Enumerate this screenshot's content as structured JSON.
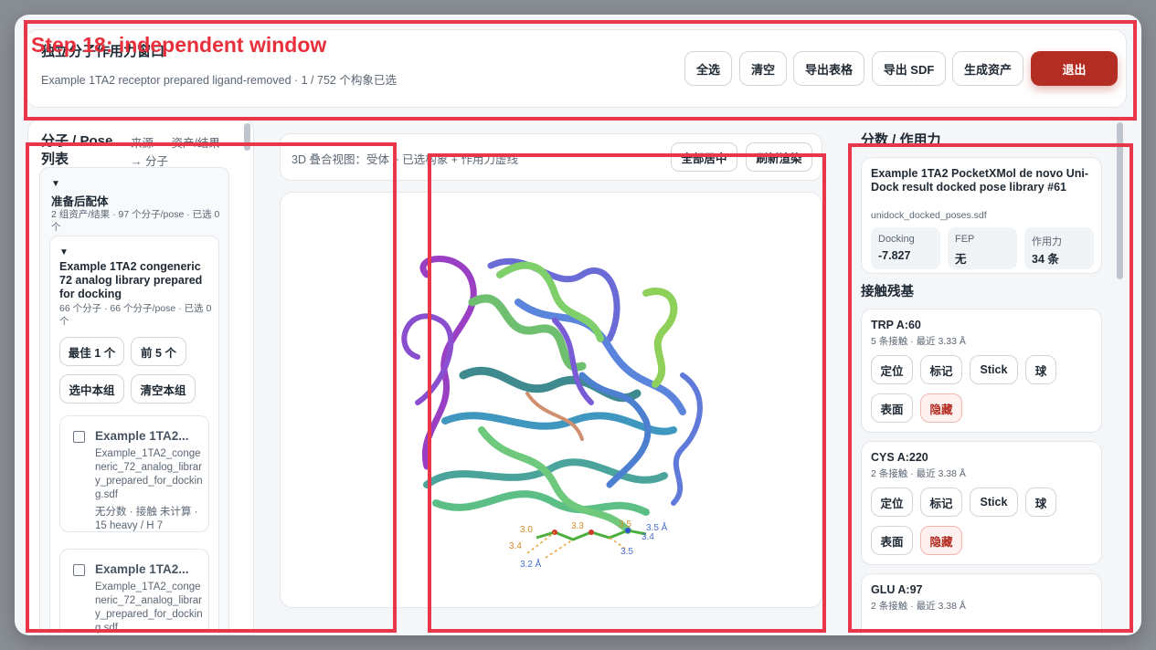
{
  "annotation": {
    "label": "Step 18: independent window"
  },
  "window": {
    "title": "独立分子作用力窗口",
    "subtitle": "Example 1TA2 receptor prepared ligand-removed · 1 / 752 个构象已选",
    "buttons": {
      "select_all": "全选",
      "clear": "清空",
      "export_table": "导出表格",
      "export_sdf": "导出 SDF",
      "generate_asset": "生成资产",
      "exit": "退出"
    }
  },
  "left_panel": {
    "title": "分子 / Pose 列表",
    "hint": "来源 → 资产/结果 → 分子",
    "group": {
      "title": "准备后配体",
      "meta": "2 组资产/结果 · 97 个分子/pose · 已选 0 个",
      "subgroup": {
        "title": "Example 1TA2 congeneric 72 analog library prepared for docking",
        "meta": "66 个分子 · 66 个分子/pose · 已选 0 个",
        "buttons": {
          "best1": "最佳 1 个",
          "top5": "前 5 个",
          "select_group": "选中本组",
          "clear_group": "清空本组"
        },
        "items": [
          {
            "name": "Example 1TA2...",
            "file": "Example_1TA2_congeneric_72_analog_library_prepared_for_docking.sdf",
            "meta": "无分数 · 接触 未计算 · 15 heavy / H 7"
          },
          {
            "name": "Example 1TA2...",
            "file": "Example_1TA2_congeneric_72_analog_library_prepared_for_docking.sdf",
            "meta": ""
          }
        ]
      }
    }
  },
  "viewer": {
    "title": "3D 叠合视图：受体 + 已选构象 + 作用力虚线",
    "center_all": "全部居中",
    "refresh": "刷新渲染",
    "distance_labels": [
      "3.0",
      "3.4",
      "3.3",
      "3.5",
      "3.5",
      "3.4",
      "3.2 Å",
      "3.5 Å"
    ]
  },
  "right_panel": {
    "title": "分数 / 作用力",
    "pose": {
      "title": "Example 1TA2 PocketXMol de novo Uni-Dock result docked pose library #61",
      "file": "unidock_docked_poses.sdf",
      "stats": [
        {
          "label": "Docking",
          "value": "-7.827"
        },
        {
          "label": "FEP",
          "value": "无"
        },
        {
          "label": "作用力",
          "value": "34 条"
        }
      ]
    },
    "contacts_title": "接触残基",
    "residues": [
      {
        "name": "TRP A:60",
        "meta": "5 条接触 · 最近 3.33 Å"
      },
      {
        "name": "CYS A:220",
        "meta": "2 条接触 · 最近 3.38 Å"
      },
      {
        "name": "GLU A:97",
        "meta": "2 条接触 · 最近 3.38 Å"
      }
    ],
    "residue_buttons": {
      "locate": "定位",
      "mark": "标记",
      "stick": "Stick",
      "sphere": "球",
      "surface": "表面",
      "hide": "隐藏"
    }
  }
}
